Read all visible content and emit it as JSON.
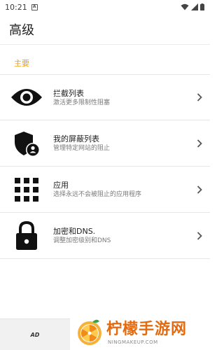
{
  "status_bar": {
    "time": "10:21",
    "app_icon_letter": "A"
  },
  "app_bar": {
    "title": "高级"
  },
  "section": {
    "title": "主要"
  },
  "items": [
    {
      "title": "拦截列表",
      "subtitle": "激活更多限制性阻塞",
      "icon": "eye-icon"
    },
    {
      "title": "我的屏蔽列表",
      "subtitle": "管理特定网站的阻止",
      "icon": "shield-user-icon"
    },
    {
      "title": "应用",
      "subtitle": "选择永远不会被阻止的应用程序",
      "icon": "apps-grid-icon"
    },
    {
      "title": "加密和DNS.",
      "subtitle": "调整加密级别和DNS",
      "icon": "lock-icon"
    }
  ],
  "bottom": {
    "ad_label": "AD",
    "watermark_title": "柠檬手游网",
    "watermark_url": "NINGMAKEUP.COM"
  },
  "colors": {
    "accent": "#f5a000",
    "icon": "#111111",
    "chevron": "#555555",
    "watermark": "#e36a0f"
  }
}
